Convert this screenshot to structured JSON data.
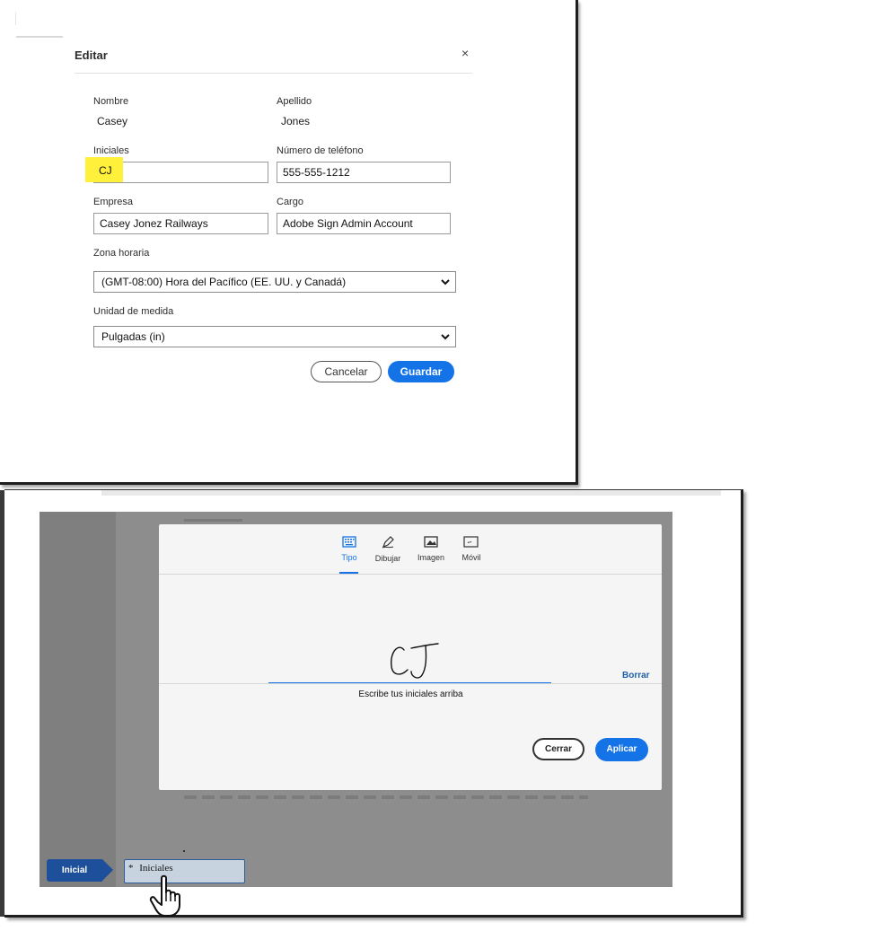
{
  "edit_dialog": {
    "title": "Editar",
    "close_glyph": "×",
    "fields": {
      "nombre_label": "Nombre",
      "nombre_value": "Casey",
      "apellido_label": "Apellido",
      "apellido_value": "Jones",
      "iniciales_label": "Iniciales",
      "iniciales_value": "CJ",
      "telefono_label": "Número de teléfono",
      "telefono_value": "555-555-1212",
      "empresa_label": "Empresa",
      "empresa_value": "Casey Jonez Railways",
      "cargo_label": "Cargo",
      "cargo_value": "Adobe Sign Admin Account",
      "zona_label": "Zona horaria",
      "zona_value": "(GMT-08:00) Hora del Pacífico (EE. UU. y Canadá)",
      "unidad_label": "Unidad de medida",
      "unidad_value": "Pulgadas (in)"
    },
    "buttons": {
      "cancel": "Cancelar",
      "save": "Guardar"
    },
    "highlight_color": "#fff03c"
  },
  "signature_dialog": {
    "tabs": [
      {
        "label": "Tipo",
        "icon": "keyboard-icon",
        "active": true
      },
      {
        "label": "Dibujar",
        "icon": "pen-draw-icon",
        "active": false
      },
      {
        "label": "Imagen",
        "icon": "image-icon",
        "active": false
      },
      {
        "label": "Móvil",
        "icon": "mobile-icon",
        "active": false
      }
    ],
    "initials_drawn": "CJ",
    "caption": "Escribe tus iniciales arriba",
    "clear_link": "Borrar",
    "buttons": {
      "close": "Cerrar",
      "apply": "Aplicar"
    },
    "accent_color": "#1473e6"
  },
  "document_field": {
    "badge": "Inicial",
    "required_marker": "*",
    "field_label": "Iniciales",
    "cursor_icon": "hand-pointer-icon"
  }
}
